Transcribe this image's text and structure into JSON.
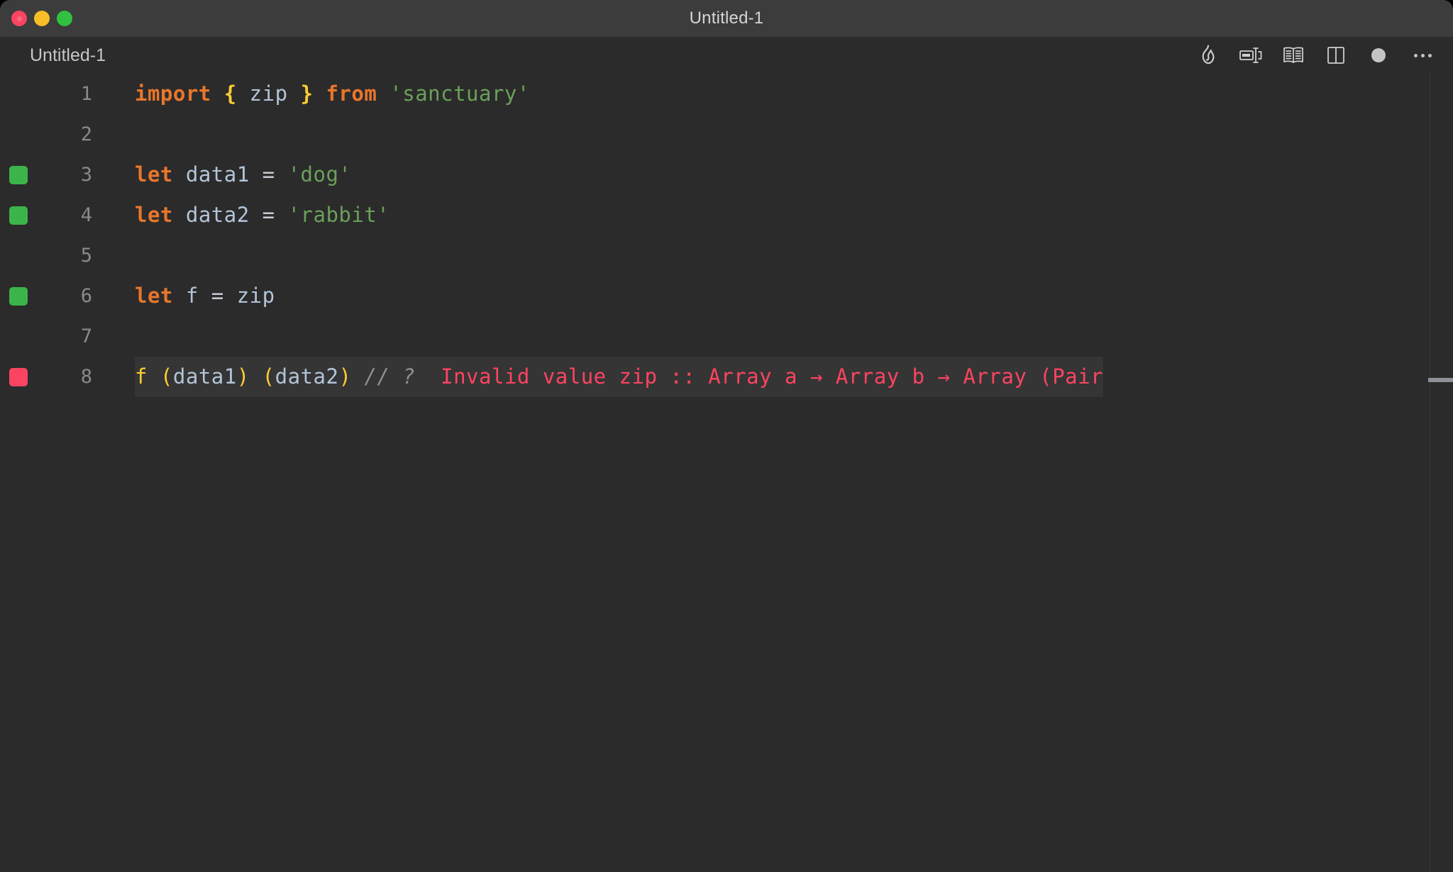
{
  "window": {
    "title": "Untitled-1",
    "traffic_lights": [
      {
        "name": "close",
        "color": "#fb4461"
      },
      {
        "name": "minimize",
        "color": "#f8bd27"
      },
      {
        "name": "maximize",
        "color": "#30c13f"
      }
    ]
  },
  "tab": {
    "label": "Untitled-1"
  },
  "toolbar": {
    "icons": [
      {
        "name": "flame-icon",
        "label": "Run / Quokka"
      },
      {
        "name": "split-resize-icon",
        "label": "Toggle panel"
      },
      {
        "name": "open-book-icon",
        "label": "Open preview"
      },
      {
        "name": "split-editor-icon",
        "label": "Split editor"
      },
      {
        "name": "record-dot-icon",
        "label": "Record"
      },
      {
        "name": "ellipsis-icon",
        "label": "More actions"
      }
    ]
  },
  "editor": {
    "colors": {
      "background": "#2b2b2b",
      "line_highlight": "#353535",
      "keyword": "#e8762c",
      "brace": "#ffcc33",
      "variable": "#b3c4d8",
      "operator": "#c7cdd6",
      "string": "#6aa05a",
      "comment": "#8c9093",
      "error": "#fb4461",
      "marker_ok": "#3cb44a",
      "marker_error": "#fb4461",
      "line_number": "#8a8a8a"
    },
    "lines": [
      {
        "number": "1",
        "marker": "none",
        "tokens": [
          {
            "cls": "t-kw",
            "text": "import"
          },
          {
            "cls": "t-op",
            "text": " "
          },
          {
            "cls": "t-brace",
            "text": "{"
          },
          {
            "cls": "t-op",
            "text": " "
          },
          {
            "cls": "t-var",
            "text": "zip"
          },
          {
            "cls": "t-op",
            "text": " "
          },
          {
            "cls": "t-brace",
            "text": "}"
          },
          {
            "cls": "t-op",
            "text": " "
          },
          {
            "cls": "t-kw",
            "text": "from"
          },
          {
            "cls": "t-op",
            "text": " "
          },
          {
            "cls": "t-str",
            "text": "'sanctuary'"
          }
        ]
      },
      {
        "number": "2",
        "marker": "none",
        "tokens": []
      },
      {
        "number": "3",
        "marker": "ok",
        "tokens": [
          {
            "cls": "t-kw",
            "text": "let"
          },
          {
            "cls": "t-op",
            "text": " "
          },
          {
            "cls": "t-var",
            "text": "data1"
          },
          {
            "cls": "t-op",
            "text": " = "
          },
          {
            "cls": "t-str",
            "text": "'dog'"
          }
        ]
      },
      {
        "number": "4",
        "marker": "ok",
        "tokens": [
          {
            "cls": "t-kw",
            "text": "let"
          },
          {
            "cls": "t-op",
            "text": " "
          },
          {
            "cls": "t-var",
            "text": "data2"
          },
          {
            "cls": "t-op",
            "text": " = "
          },
          {
            "cls": "t-str",
            "text": "'rabbit'"
          }
        ]
      },
      {
        "number": "5",
        "marker": "none",
        "tokens": []
      },
      {
        "number": "6",
        "marker": "ok",
        "tokens": [
          {
            "cls": "t-kw",
            "text": "let"
          },
          {
            "cls": "t-op",
            "text": " "
          },
          {
            "cls": "t-var",
            "text": "f"
          },
          {
            "cls": "t-op",
            "text": " = "
          },
          {
            "cls": "t-var",
            "text": "zip"
          }
        ]
      },
      {
        "number": "7",
        "marker": "none",
        "tokens": []
      },
      {
        "number": "8",
        "marker": "err",
        "highlight": true,
        "tokens": [
          {
            "cls": "t-fn",
            "text": "f"
          },
          {
            "cls": "t-op",
            "text": " "
          },
          {
            "cls": "t-paren",
            "text": "("
          },
          {
            "cls": "t-var",
            "text": "data1"
          },
          {
            "cls": "t-paren",
            "text": ")"
          },
          {
            "cls": "t-op",
            "text": " "
          },
          {
            "cls": "t-paren",
            "text": "("
          },
          {
            "cls": "t-var",
            "text": "data2"
          },
          {
            "cls": "t-paren",
            "text": ")"
          },
          {
            "cls": "t-op",
            "text": " "
          },
          {
            "cls": "t-comment",
            "text": "// ?"
          },
          {
            "cls": "t-op",
            "text": "  "
          },
          {
            "cls": "t-err",
            "text": "Invalid value zip :: Array a → Array b → Array (Pair"
          }
        ]
      }
    ]
  }
}
